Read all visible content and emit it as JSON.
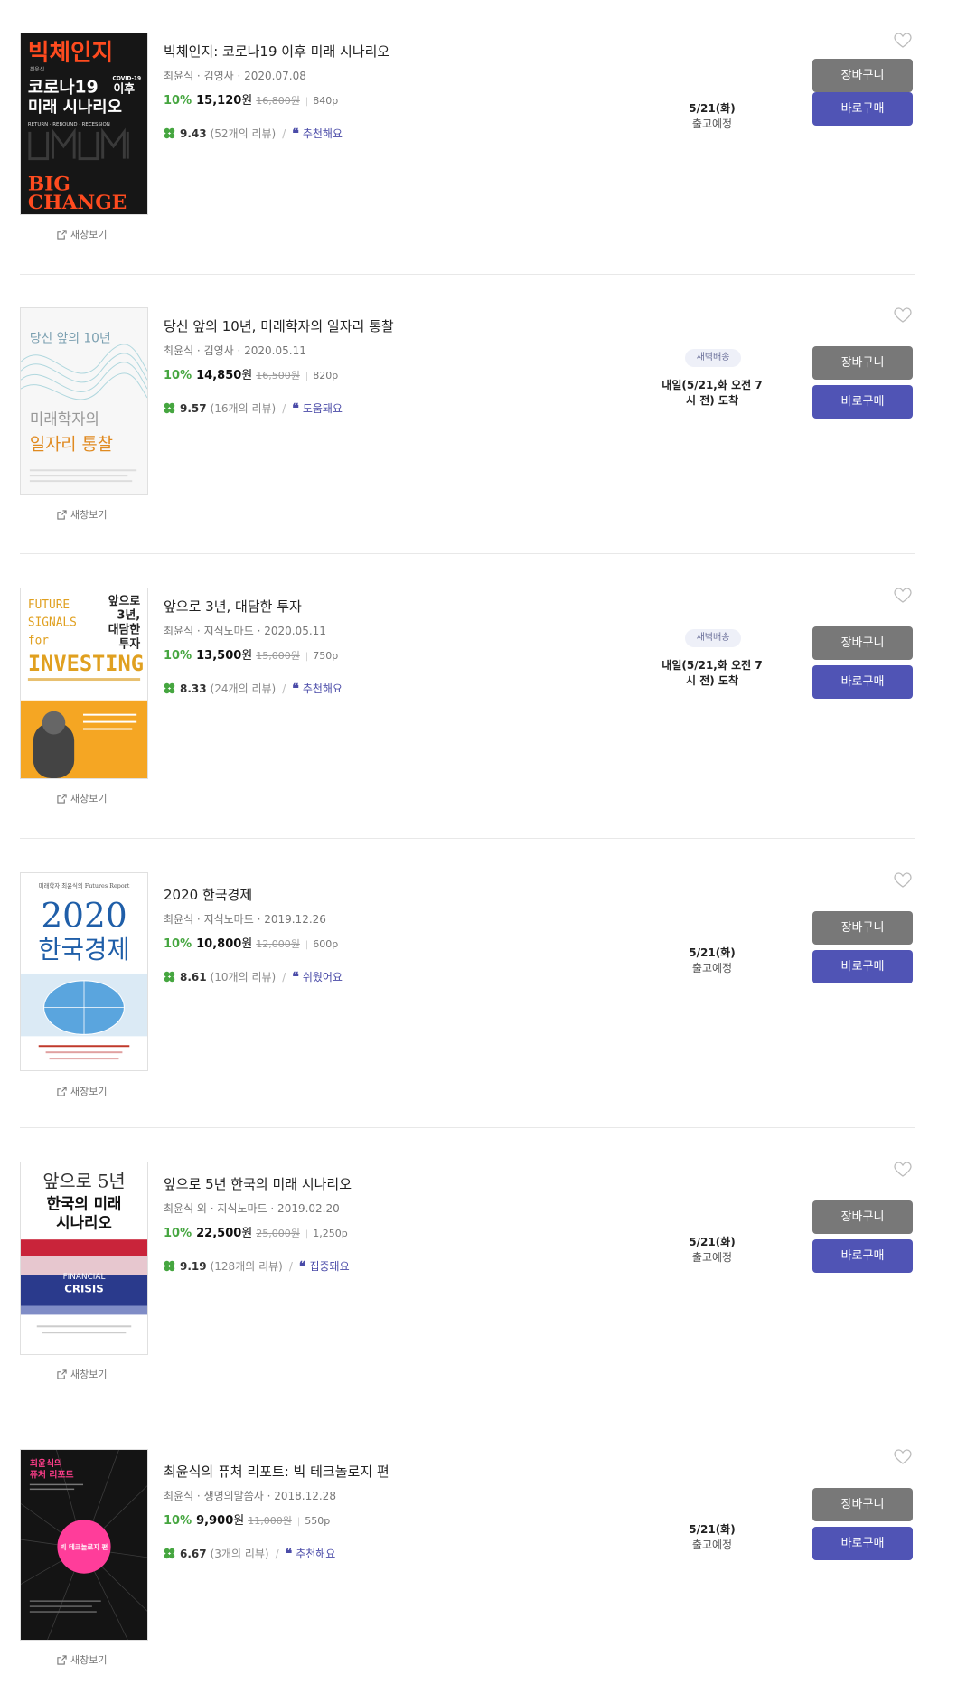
{
  "new_window_label": "새창보기",
  "cart_label": "장바구니",
  "buy_label": "바로구매",
  "colors": {
    "discount": "#46a640",
    "keyword": "#4a4ba8",
    "cart_button": "#787878",
    "buy_button": "#5054b5"
  },
  "books": [
    {
      "title": "빅체인지: 코로나19 이후 미래 시나리오",
      "meta": "최윤식 · 김영사 · 2020.07.08",
      "discount": "10%",
      "price": "15,120",
      "won": "원",
      "original_price": "16,800원",
      "points": "840p",
      "rating": "9.43",
      "reviews": "(52개의 리뷰)",
      "keyword": "추천해요",
      "shipping_badge": "",
      "shipping_line1": "5/21(화)",
      "shipping_line2": "출고예정",
      "cover": {
        "title_line1": "빅체인지",
        "small_author": "최윤식",
        "covid": "COVID-19",
        "line2a": "코로나19",
        "line2b": "이후",
        "line3": "미래 시나리오",
        "tagline": "RETURN · REBOUND · RECESSION",
        "big": "BIG",
        "change": "CHANGE"
      }
    },
    {
      "title": "당신 앞의 10년, 미래학자의 일자리 통찰",
      "meta": "최윤식 · 김영사 · 2020.05.11",
      "discount": "10%",
      "price": "14,850",
      "won": "원",
      "original_price": "16,500원",
      "points": "820p",
      "rating": "9.57",
      "reviews": "(16개의 리뷰)",
      "keyword": "도움돼요",
      "shipping_badge": "새벽배송",
      "shipping_line1": "내일(5/21,화 오전 7",
      "shipping_line2": "시 전) 도착",
      "cover": {
        "line1": "당신 앞의 10년",
        "line2": "미래학자의",
        "line3": "일자리 통찰"
      }
    },
    {
      "title": "앞으로 3년, 대담한 투자",
      "meta": "최윤식 · 지식노마드 · 2020.05.11",
      "discount": "10%",
      "price": "13,500",
      "won": "원",
      "original_price": "15,000원",
      "points": "750p",
      "rating": "8.33",
      "reviews": "(24개의 리뷰)",
      "keyword": "추천해요",
      "shipping_badge": "새벽배송",
      "shipping_line1": "내일(5/21,화 오전 7",
      "shipping_line2": "시 전) 도착",
      "cover": {
        "future": "FUTURE",
        "signals": "SIGNALS",
        "for": "for",
        "investing": "INVESTING",
        "kr1": "앞으로",
        "kr2": "3년,",
        "kr3": "대담한",
        "kr4": "투자"
      }
    },
    {
      "title": "2020 한국경제",
      "meta": "최윤식 · 지식노마드 · 2019.12.26",
      "discount": "10%",
      "price": "10,800",
      "won": "원",
      "original_price": "12,000원",
      "points": "600p",
      "rating": "8.61",
      "reviews": "(10개의 리뷰)",
      "keyword": "쉬웠어요",
      "shipping_badge": "",
      "shipping_line1": "5/21(화)",
      "shipping_line2": "출고예정",
      "cover": {
        "top": "미래학자 최윤식의 Futures Report",
        "year": "2020",
        "kr": "한국경제"
      }
    },
    {
      "title": "앞으로 5년 한국의 미래 시나리오",
      "meta": "최윤식 외 · 지식노마드 · 2019.02.20",
      "discount": "10%",
      "price": "22,500",
      "won": "원",
      "original_price": "25,000원",
      "points": "1,250p",
      "rating": "9.19",
      "reviews": "(128개의 리뷰)",
      "keyword": "집중돼요",
      "shipping_badge": "",
      "shipping_line1": "5/21(화)",
      "shipping_line2": "출고예정",
      "cover": {
        "line1": "앞으로 5년",
        "line2": "한국의 미래",
        "line3": "시나리오",
        "financial": "FINANCIAL",
        "crisis": "CRISIS"
      }
    },
    {
      "title": "최윤식의 퓨처 리포트: 빅 테크놀로지 편",
      "meta": "최윤식 · 생명의말씀사 · 2018.12.28",
      "discount": "10%",
      "price": "9,900",
      "won": "원",
      "original_price": "11,000원",
      "points": "550p",
      "rating": "6.67",
      "reviews": "(3개의 리뷰)",
      "keyword": "추천해요",
      "shipping_badge": "",
      "shipping_line1": "5/21(화)",
      "shipping_line2": "출고예정",
      "cover": {
        "line1": "최윤식의",
        "line2": "퓨처 리포트",
        "circle": "빅 테크놀로지 편"
      }
    }
  ]
}
